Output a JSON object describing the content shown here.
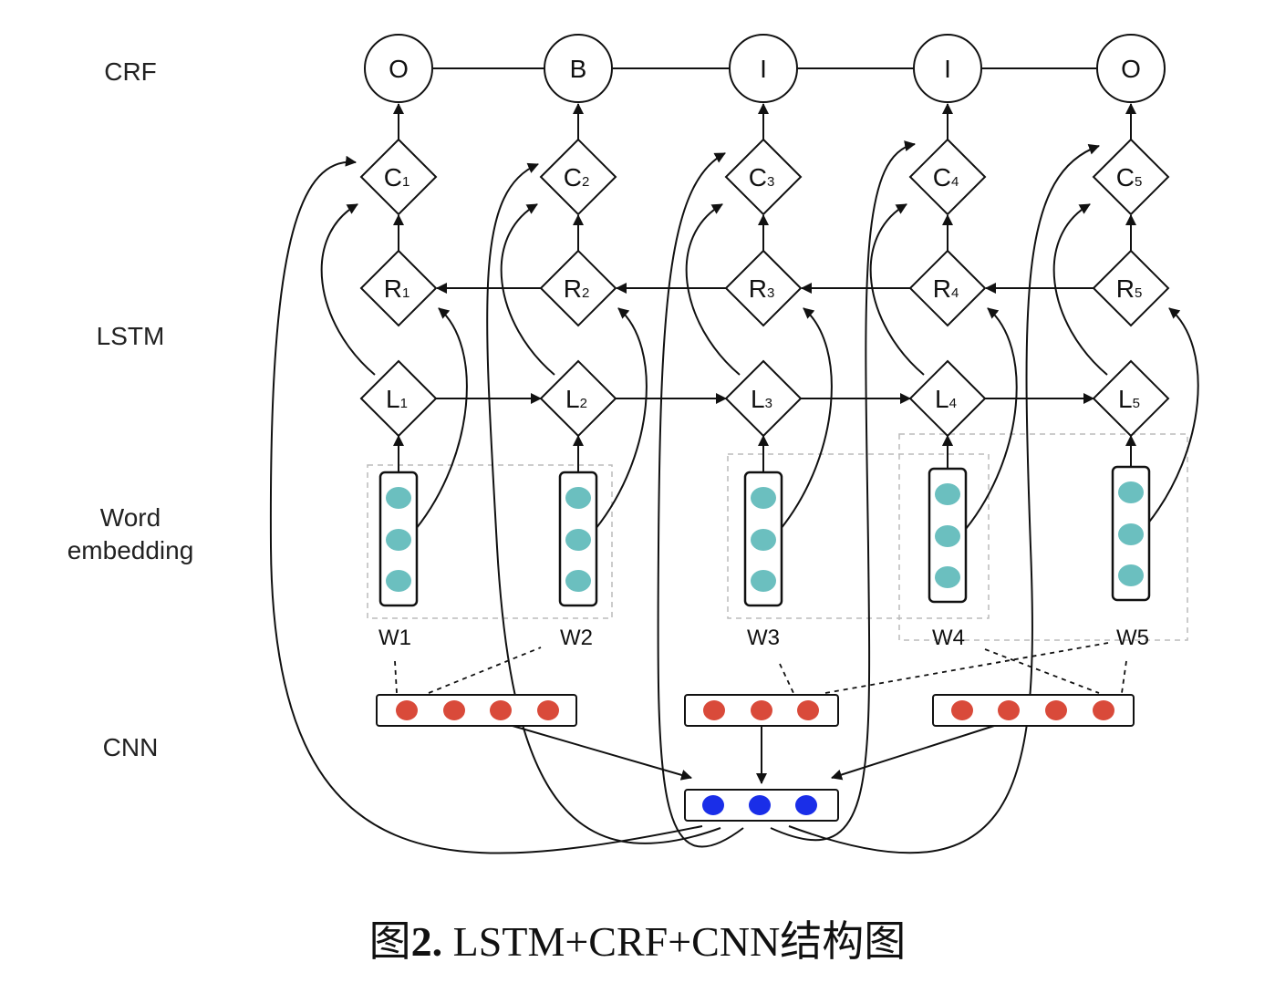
{
  "layers": {
    "crf": "CRF",
    "lstm": "LSTM",
    "word_embedding_line1": "Word",
    "word_embedding_line2": "embedding",
    "cnn": "CNN"
  },
  "crf_tags": [
    "O",
    "B",
    "I",
    "I",
    "O"
  ],
  "c_nodes": [
    {
      "letter": "C",
      "sub": "1"
    },
    {
      "letter": "C",
      "sub": "2"
    },
    {
      "letter": "C",
      "sub": "3"
    },
    {
      "letter": "C",
      "sub": "4"
    },
    {
      "letter": "C",
      "sub": "5"
    }
  ],
  "r_nodes": [
    {
      "letter": "R",
      "sub": "1"
    },
    {
      "letter": "R",
      "sub": "2"
    },
    {
      "letter": "R",
      "sub": "3"
    },
    {
      "letter": "R",
      "sub": "4"
    },
    {
      "letter": "R",
      "sub": "5"
    }
  ],
  "l_nodes": [
    {
      "letter": "L",
      "sub": "1"
    },
    {
      "letter": "L",
      "sub": "2"
    },
    {
      "letter": "L",
      "sub": "3"
    },
    {
      "letter": "L",
      "sub": "4"
    },
    {
      "letter": "L",
      "sub": "5"
    }
  ],
  "words": [
    "W1",
    "W2",
    "W3",
    "W4",
    "W5"
  ],
  "colors": {
    "embedding_dot": "#6bbfbf",
    "cnn_dot": "#d94a3a",
    "pooled_dot": "#1a2ee8",
    "line": "#111111",
    "dashed": "#bbbbbb"
  },
  "caption": {
    "prefix": "图",
    "number": "2.",
    "text": " LSTM+CRF+CNN结构图"
  }
}
